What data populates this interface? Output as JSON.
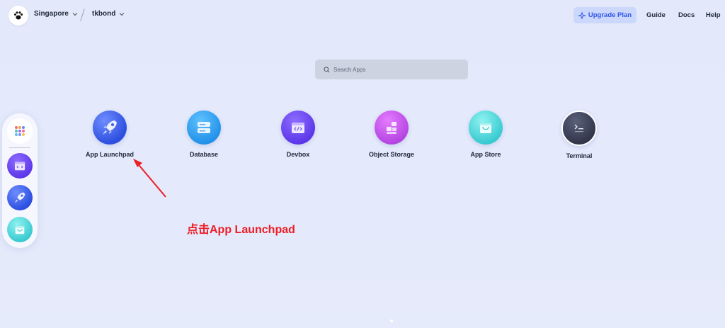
{
  "header": {
    "region": "Singapore",
    "user": "tkbond",
    "upgrade_label": "Upgrade Plan",
    "links": [
      "Guide",
      "Docs",
      "Help"
    ]
  },
  "search": {
    "placeholder": "Search Apps"
  },
  "apps": [
    {
      "label": "App Launchpad",
      "icon": "rocket-icon"
    },
    {
      "label": "Database",
      "icon": "database-icon"
    },
    {
      "label": "Devbox",
      "icon": "devbox-code-icon"
    },
    {
      "label": "Object Storage",
      "icon": "object-storage-icon"
    },
    {
      "label": "App Store",
      "icon": "shopping-bag-icon"
    },
    {
      "label": "Terminal",
      "icon": "terminal-icon"
    }
  ],
  "dock": {
    "items": [
      "grid-apps-icon",
      "devbox-code-icon",
      "rocket-icon",
      "shopping-bag-icon"
    ]
  },
  "annotation": {
    "text": "点击App Launchpad",
    "color": "#ee1c25"
  },
  "colors": {
    "accent": "#2f54eb",
    "background": "#e4e9fb"
  }
}
